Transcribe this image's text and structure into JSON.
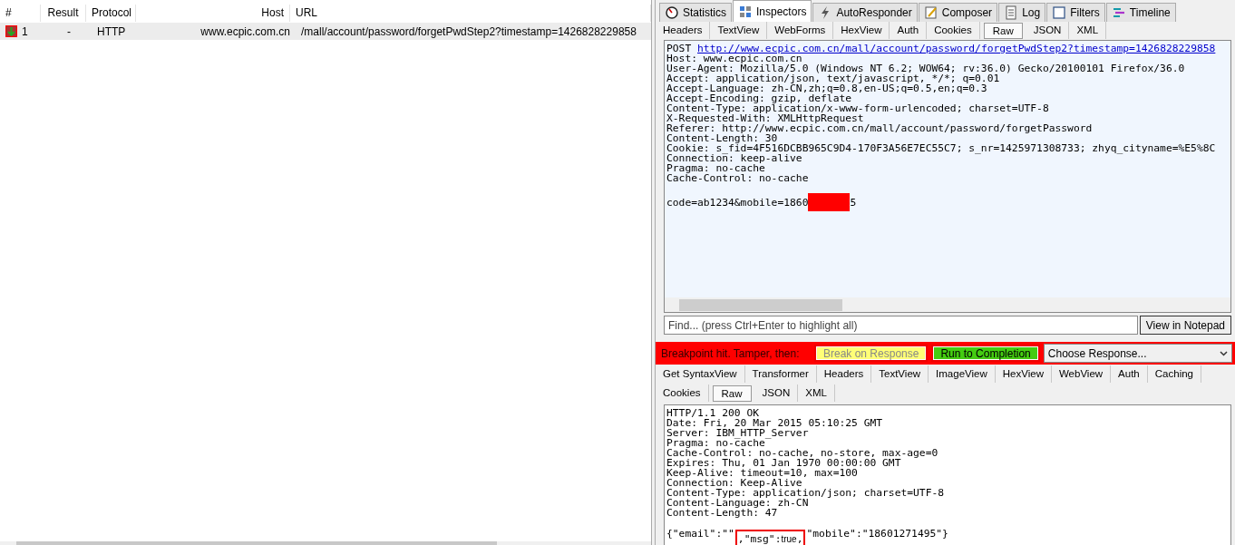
{
  "session_list": {
    "columns": [
      {
        "label": "#"
      },
      {
        "label": "Result"
      },
      {
        "label": "Protocol"
      },
      {
        "label": "Host"
      },
      {
        "label": "URL"
      }
    ],
    "rows": [
      {
        "number": "1",
        "result": "-",
        "protocol": "HTTP",
        "host": "www.ecpic.com.cn",
        "url": "/mall/account/password/forgetPwdStep2?timestamp=1426828229858"
      }
    ]
  },
  "inspector_tabs": [
    {
      "label": "Statistics",
      "selected": false
    },
    {
      "label": "Inspectors",
      "selected": true
    },
    {
      "label": "AutoResponder",
      "selected": false
    },
    {
      "label": "Composer",
      "selected": false
    },
    {
      "label": "Log",
      "selected": false
    },
    {
      "label": "Filters",
      "selected": false
    },
    {
      "label": "Timeline",
      "selected": false
    }
  ],
  "request_tabs": [
    {
      "label": "Headers",
      "selected": false
    },
    {
      "label": "TextView",
      "selected": false
    },
    {
      "label": "WebForms",
      "selected": false
    },
    {
      "label": "HexView",
      "selected": false
    },
    {
      "label": "Auth",
      "selected": false
    },
    {
      "label": "Cookies",
      "selected": false
    },
    {
      "label": "Raw",
      "selected": true
    },
    {
      "label": "JSON",
      "selected": false
    },
    {
      "label": "XML",
      "selected": false
    }
  ],
  "request_raw": {
    "method": "POST",
    "url": "http://www.ecpic.com.cn/mall/account/password/forgetPwdStep2?timestamp=1426828229858",
    "headers": [
      "Host: www.ecpic.com.cn",
      "User-Agent: Mozilla/5.0 (Windows NT 6.2; WOW64; rv:36.0) Gecko/20100101 Firefox/36.0",
      "Accept: application/json, text/javascript, */*; q=0.01",
      "Accept-Language: zh-CN,zh;q=0.8,en-US;q=0.5,en;q=0.3",
      "Accept-Encoding: gzip, deflate",
      "Content-Type: application/x-www-form-urlencoded; charset=UTF-8",
      "X-Requested-With: XMLHttpRequest",
      "Referer: http://www.ecpic.com.cn/mall/account/password/forgetPassword",
      "Content-Length: 30",
      "Cookie: s_fid=4F516DCBB965C9D4-170F3A56E7EC55C7; s_nr=1425971308733; zhyq_cityname=%E5%8C",
      "Connection: keep-alive",
      "Pragma: no-cache",
      "Cache-Control: no-cache"
    ],
    "body_before": "code=ab1234&mobile=1860",
    "body_after": "5"
  },
  "find": {
    "placeholder": "Find... (press Ctrl+Enter to highlight all)",
    "button": "View in Notepad"
  },
  "breakpoint_bar": {
    "message": "Breakpoint hit. Tamper, then:",
    "break_on_response": "Break on Response",
    "run_to_completion": "Run to Completion",
    "choose_response": "Choose Response..."
  },
  "response_tab_rows": [
    {
      "tabs": [
        {
          "label": "Get SyntaxView",
          "selected": false
        },
        {
          "label": "Transformer",
          "selected": false
        },
        {
          "label": "Headers",
          "selected": false
        },
        {
          "label": "TextView",
          "selected": false
        },
        {
          "label": "ImageView",
          "selected": false
        },
        {
          "label": "HexView",
          "selected": false
        },
        {
          "label": "WebView",
          "selected": false
        },
        {
          "label": "Auth",
          "selected": false
        },
        {
          "label": "Caching",
          "selected": false
        }
      ]
    },
    {
      "tabs": [
        {
          "label": "Cookies",
          "selected": false
        },
        {
          "label": "Raw",
          "selected": true
        },
        {
          "label": "JSON",
          "selected": false
        },
        {
          "label": "XML",
          "selected": false
        }
      ]
    }
  ],
  "response_raw": {
    "headers": [
      "HTTP/1.1 200 OK",
      "Date: Fri, 20 Mar 2015 05:10:25 GMT",
      "Server: IBM_HTTP_Server",
      "Pragma: no-cache",
      "Cache-Control: no-cache, no-store, max-age=0",
      "Expires: Thu, 01 Jan 1970 00:00:00 GMT",
      "Keep-Alive: timeout=10, max=100",
      "Connection: Keep-Alive",
      "Content-Type: application/json; charset=UTF-8",
      "Content-Language: zh-CN",
      "Content-Length: 47"
    ],
    "body_before": "{\"email\":\"\"",
    "boxed": [
      {
        "text": ",\"msg\":",
        "small": false
      },
      {
        "text": "true",
        "small": true
      },
      {
        "text": ",",
        "small": false
      }
    ],
    "body_after": "\"mobile\":\"18601271495\"}"
  }
}
